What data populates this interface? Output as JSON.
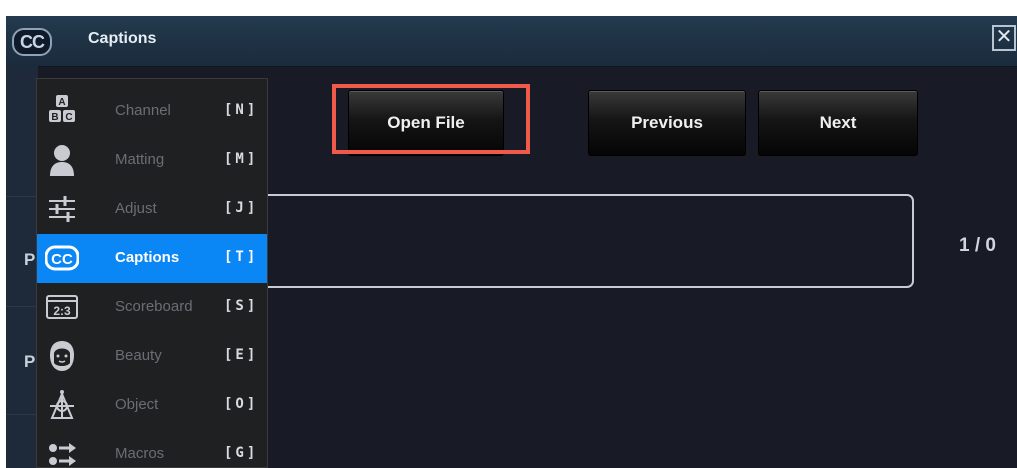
{
  "window": {
    "title": "Captions",
    "icon_text": "CC",
    "close_glyph": "✕"
  },
  "toolbar": {
    "open_file_label": "Open File",
    "previous_label": "Previous",
    "next_label": "Next"
  },
  "caption_panel": {
    "counter": "1 / 0"
  },
  "left_rows": {
    "partial_1": "P",
    "partial_2": "P"
  },
  "menu": {
    "items": [
      {
        "label": "Channel",
        "key": "[N]",
        "icon": "abc-channel-icon",
        "active": false
      },
      {
        "label": "Matting",
        "key": "[M]",
        "icon": "person-matting-icon",
        "active": false
      },
      {
        "label": "Adjust",
        "key": "[J]",
        "icon": "sliders-adjust-icon",
        "active": false
      },
      {
        "label": "Captions",
        "key": "[T]",
        "icon": "cc-captions-icon",
        "active": true
      },
      {
        "label": "Scoreboard",
        "key": "[S]",
        "icon": "scoreboard-icon",
        "active": false
      },
      {
        "label": "Beauty",
        "key": "[E]",
        "icon": "face-beauty-icon",
        "active": false
      },
      {
        "label": "Object",
        "key": "[O]",
        "icon": "object-icon",
        "active": false
      },
      {
        "label": "Macros",
        "key": "[G]",
        "icon": "macros-icon",
        "active": false
      }
    ],
    "icon_texts": {
      "channel_a": "A",
      "channel_b": "B",
      "channel_c": "C",
      "captions": "CC",
      "scoreboard": "2:3"
    }
  },
  "colors": {
    "highlight": "#f05a4a",
    "active_item": "#0a86f5",
    "background": "#181a25"
  }
}
